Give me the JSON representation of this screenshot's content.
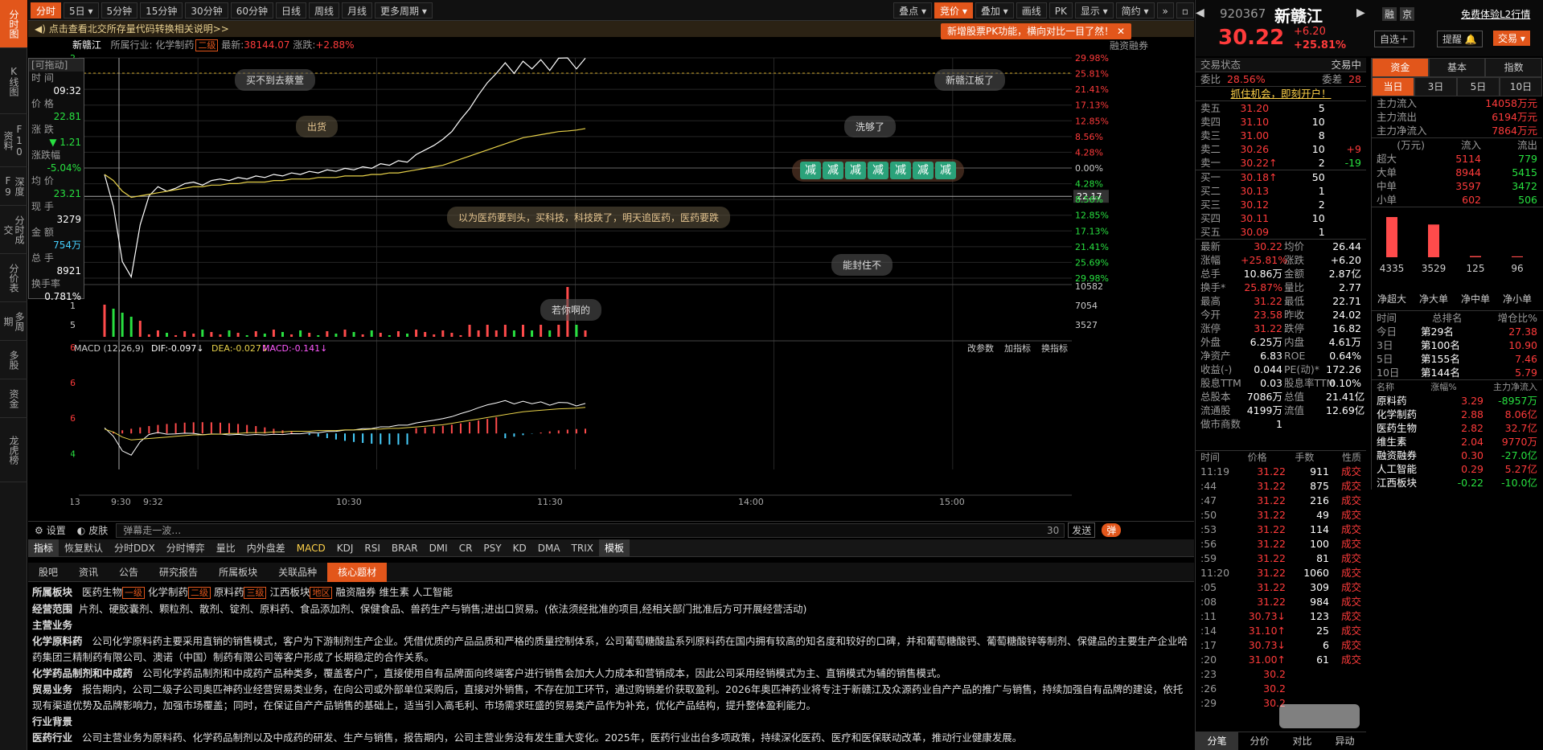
{
  "leftnav": [
    "分时图",
    "K线图",
    "F10资料",
    "深度F9",
    "分时成交",
    "分价表",
    "多周期",
    "多股",
    "资金",
    "龙虎榜"
  ],
  "toolbar": {
    "periods": [
      "分时",
      "5日",
      "5分钟",
      "15分钟",
      "30分钟",
      "60分钟",
      "日线",
      "周线",
      "月线",
      "更多周期"
    ],
    "right": [
      "叠点",
      "竞价",
      "叠加",
      "画线",
      "PK",
      "显示",
      "简约"
    ]
  },
  "notice": "点击查看北交所存量代码转换相关说明>>",
  "orangetip": "新增股票PK功能，横向对比一目了然！",
  "stock": {
    "name": "新赣江",
    "industry_label": "所属行业:",
    "industry": "化学制药",
    "industry_tag": "二级",
    "latest_label": "最新:",
    "latest": "38144.07",
    "change_label": "涨跌:",
    "change": "+2.88%",
    "margin": "融资融券"
  },
  "chart": {
    "left_axis": [
      "31.22",
      "30.31",
      "17.85",
      "16.82"
    ],
    "right_pct": [
      "29.98%",
      "25.81%",
      "21.41%",
      "17.13%",
      "12.85%",
      "8.56%",
      "4.28%",
      "0.00%",
      "4.28%",
      "8.56%",
      "12.85%",
      "17.13%",
      "21.41%",
      "25.69%",
      "29.98%"
    ],
    "crosshair_value": "22.17",
    "vol_axis": [
      "1637",
      "1091",
      "545"
    ],
    "vol_right": [
      "10582",
      "7054",
      "3527"
    ],
    "macd_label": "MACD (12,26,9)",
    "dif": "DIF:-0.097↓",
    "dea": "DEA:-0.027↓",
    "macd": "MACD:-0.141↓",
    "macd_axis": [
      "0.96",
      "0.56",
      "0.16",
      "-0.24"
    ],
    "macd_tools": [
      "改参数",
      "加指标",
      "换指标"
    ],
    "time_axis": [
      "08/13",
      "9:30",
      "9:32",
      "10:30",
      "11:30",
      "14:00",
      "15:00"
    ],
    "prices": [
      23.6,
      21.5,
      17.9,
      16.9,
      20.3,
      22.2,
      22.8,
      22.5,
      22.7,
      23.0,
      23.1,
      22.9,
      23.2,
      23.3,
      23.2,
      23.4,
      23.3,
      23.5,
      23.4,
      23.6,
      23.5,
      23.7,
      23.6,
      23.8,
      23.7,
      23.9,
      23.8,
      24.0,
      23.9,
      24.1,
      24.0,
      24.3,
      24.2,
      24.5,
      24.4,
      24.9,
      25.2,
      25.5,
      25.9,
      26.4,
      27.2,
      27.9,
      28.8,
      29.6,
      30.2,
      30.9,
      30.2,
      31.0,
      30.5,
      31.1,
      30.4,
      31.2,
      31.22,
      30.5,
      31.2
    ],
    "avg": [
      23.6,
      23.2,
      22.5,
      22.1,
      22.2,
      22.3,
      22.4,
      22.5,
      22.6,
      22.7,
      22.8,
      22.8,
      22.9,
      22.9,
      23.0,
      23.0,
      23.1,
      23.1,
      23.1,
      23.2,
      23.2,
      23.3,
      23.3,
      23.3,
      23.4,
      23.4,
      23.4,
      23.5,
      23.5,
      23.5,
      23.6,
      23.6,
      23.7,
      23.7,
      23.8,
      23.9,
      24.0,
      24.1,
      24.2,
      24.4,
      24.6,
      24.8,
      25.0,
      25.2,
      25.4,
      25.6,
      25.8,
      26.0,
      26.1,
      26.2,
      26.3,
      26.4,
      26.44,
      26.5,
      26.6
    ]
  },
  "info": {
    "drag": "[可拖动]",
    "time_label": "时 间",
    "time": "09:32",
    "price_label": "价 格",
    "price": "22.81",
    "chg_label": "涨 跌",
    "chg": "▼ 1.21",
    "pct_label": "涨跌幅",
    "pct": "-5.04%",
    "avg_label": "均 价",
    "avg": "23.21",
    "now_label": "现 手",
    "now": "3279",
    "amt_label": "金 额",
    "amt": "754万",
    "tot_label": "总 手",
    "tot": "8921",
    "turn_label": "换手率",
    "turn": "0.781%"
  },
  "bubbles": [
    "买不到去蔡萱",
    "新赣江板了",
    "出货",
    "洗够了",
    "以为医药要到头，买科技，科技跌了，明天追医药，医药要跌",
    "能封住不",
    "若你啊的"
  ],
  "jian": [
    "减",
    "减",
    "减",
    "减",
    "减",
    "减",
    "减"
  ],
  "chartbottom": {
    "settings": "设置",
    "skin": "皮肤",
    "danmu_placeholder": "弹幕走一波…",
    "count": "30",
    "send": "发送",
    "danmu": "弹"
  },
  "indtabs": [
    "指标",
    "恢复默认",
    "分时DDX",
    "分时博弈",
    "量比",
    "内外盘差",
    "MACD",
    "KDJ",
    "RSI",
    "BRAR",
    "DMI",
    "CR",
    "PSY",
    "KD",
    "DMA",
    "TRIX",
    "模板"
  ],
  "f10tabs": [
    "股吧",
    "资讯",
    "公告",
    "研究报告",
    "所属板块",
    "关联品种",
    "核心题材"
  ],
  "f10": {
    "l1": {
      "h": "所属板块",
      "items": [
        "医药生物",
        "化学制药",
        "原料药",
        "江西板块",
        "融资融券",
        "维生素",
        "人工智能"
      ],
      "tags": [
        "一级",
        "二级",
        "三级",
        "地区"
      ]
    },
    "l2": {
      "h": "经营范围",
      "t": "片剂、硬胶囊剂、颗粒剂、散剂、锭剂、原料药、食品添加剂、保健食品、兽药生产与销售;进出口贸易。(依法须经批准的项目,经相关部门批准后方可开展经营活动)"
    },
    "l3": "主营业务",
    "l4": {
      "h": "化学原料药",
      "t": "公司化学原料药主要采用直销的销售模式，客户为下游制剂生产企业。凭借优质的产品品质和严格的质量控制体系，公司葡萄糖酸盐系列原料药在国内拥有较高的知名度和较好的口碑，并和葡萄糖酸钙、葡萄糖酸锌等制剂、保健品的主要生产企业哈药集团三精制药有限公司、澳诺（中国）制药有限公司等客户形成了长期稳定的合作关系。"
    },
    "l5": {
      "h": "化学药品制剂和中成药",
      "t": "公司化学药品制剂和中成药产品种类多，覆盖客户广，直接使用自有品牌面向终端客户进行销售会加大人力成本和营销成本，因此公司采用经销模式为主、直销模式为辅的销售模式。"
    },
    "l6": {
      "h": "贸易业务",
      "t": "报告期内，公司二级子公司奥匹神药业经营贸易类业务，在向公司或外部单位采购后，直接对外销售，不存在加工环节，通过购销差价获取盈利。2026年奥匹神药业将专注于新赣江及众源药业自产产品的推广与销售，持续加强自有品牌的建设，依托现有渠道优势及品牌影响力，加强市场覆盖；同时，在保证自产产品销售的基础上，适当引入高毛利、市场需求旺盛的贸易类产品作为补充，优化产品结构，提升整体盈利能力。"
    },
    "l7": "行业背景",
    "l8": {
      "h": "医药行业",
      "t": "公司主营业务为原料药、化学药品制剂以及中成药的研发、生产与销售，报告期内，公司主营业务没有发生重大变化。2025年，医药行业出台多项政策，持续深化医药、医疗和医保联动改革，推动行业健康发展。"
    }
  },
  "right": {
    "code": "920367",
    "name": "新赣江",
    "price": "30.22",
    "chg": "+6.20",
    "pct": "+25.81%",
    "badges": [
      "融",
      "京"
    ],
    "trial": "免费体验L2行情",
    "btn_add": "自选＋",
    "btn_alert": "提醒",
    "btn_trade": "交易",
    "status_label": "交易状态",
    "status": "交易中",
    "wb_label": "委比",
    "wb": "28.56%",
    "wc_label": "委差",
    "wc": "28",
    "promo": "抓住机会，即刻开户！",
    "sells": [
      [
        "卖五",
        "31.20",
        "5",
        ""
      ],
      [
        "卖四",
        "31.10",
        "10",
        ""
      ],
      [
        "卖三",
        "31.00",
        "8",
        ""
      ],
      [
        "卖二",
        "30.26",
        "10",
        "+9"
      ],
      [
        "卖一",
        "30.22↑",
        "2",
        "-19"
      ]
    ],
    "buys": [
      [
        "买一",
        "30.18↑",
        "50"
      ],
      [
        "买二",
        "30.13",
        "1"
      ],
      [
        "买三",
        "30.12",
        "2"
      ],
      [
        "买四",
        "30.11",
        "10"
      ],
      [
        "买五",
        "30.09",
        "1"
      ]
    ],
    "quote": [
      [
        "最新",
        "30.22",
        "均价",
        "26.44"
      ],
      [
        "涨幅",
        "+25.81%",
        "涨跌",
        "+6.20"
      ],
      [
        "总手",
        "10.86万",
        "金额",
        "2.87亿"
      ],
      [
        "换手*",
        "25.87%",
        "量比",
        "2.77"
      ],
      [
        "最高",
        "31.22",
        "最低",
        "22.71"
      ],
      [
        "今开",
        "23.58",
        "昨收",
        "24.02"
      ],
      [
        "涨停",
        "31.22",
        "跌停",
        "16.82"
      ],
      [
        "外盘",
        "6.25万",
        "内盘",
        "4.61万"
      ],
      [
        "净资产",
        "6.83",
        "ROE",
        "0.64%"
      ],
      [
        "收益(-)",
        "0.044",
        "PE(动)*",
        "172.26"
      ],
      [
        "股息TTM",
        "0.03",
        "股息率TTM",
        "0.10%"
      ],
      [
        "总股本",
        "7086万",
        "总值",
        "21.41亿"
      ],
      [
        "流通股",
        "4199万",
        "流值",
        "12.69亿"
      ],
      [
        "做市商数",
        "1",
        "",
        ""
      ]
    ],
    "fund_tabs": [
      "资金",
      "基本",
      "指数"
    ],
    "day_tabs": [
      "当日",
      "3日",
      "5日",
      "10日"
    ],
    "flows": [
      [
        "主力流入",
        "14058万元"
      ],
      [
        "主力流出",
        "6194万元"
      ],
      [
        "主力净流入",
        "7864万元"
      ]
    ],
    "flow_head": [
      "(万元)",
      "流入",
      "流出"
    ],
    "flow_rows": [
      [
        "超大",
        "5114",
        "779"
      ],
      [
        "大单",
        "8944",
        "5415"
      ],
      [
        "中单",
        "3597",
        "3472"
      ],
      [
        "小单",
        "602",
        "506"
      ]
    ],
    "net_bars": {
      "values": [
        4335,
        3529,
        125,
        96
      ],
      "labels": [
        "净超大",
        "净大单",
        "净中单",
        "净小单"
      ]
    },
    "rank_head": [
      "时间",
      "总排名",
      "增仓比%"
    ],
    "ranks": [
      [
        "今日",
        "第29名",
        "27.38"
      ],
      [
        "3日",
        "第100名",
        "10.90"
      ],
      [
        "5日",
        "第155名",
        "7.46"
      ],
      [
        "10日",
        "第144名",
        "5.79"
      ]
    ],
    "sect_head": [
      "名称",
      "涨幅%",
      "主力净流入"
    ],
    "sectors": [
      [
        "原料药",
        "3.29",
        "-8957万"
      ],
      [
        "化学制药",
        "2.88",
        "8.06亿"
      ],
      [
        "医药生物",
        "2.82",
        "32.7亿"
      ],
      [
        "维生素",
        "2.04",
        "9770万"
      ],
      [
        "融资融券",
        "0.30",
        "-27.0亿"
      ],
      [
        "人工智能",
        "0.29",
        "5.27亿"
      ],
      [
        "江西板块",
        "-0.22",
        "-10.0亿"
      ]
    ],
    "tick_head": [
      "时间",
      "价格",
      "手数",
      "性质"
    ],
    "ticks": [
      [
        "11:19",
        "31.22",
        "911",
        "成交"
      ],
      [
        ":44",
        "31.22",
        "875",
        "成交"
      ],
      [
        ":47",
        "31.22",
        "216",
        "成交"
      ],
      [
        ":50",
        "31.22",
        "49",
        "成交"
      ],
      [
        ":53",
        "31.22",
        "114",
        "成交"
      ],
      [
        ":56",
        "31.22",
        "100",
        "成交"
      ],
      [
        ":59",
        "31.22",
        "81",
        "成交"
      ],
      [
        "11:20",
        "31.22",
        "1060",
        "成交"
      ],
      [
        ":05",
        "31.22",
        "309",
        "成交"
      ],
      [
        ":08",
        "31.22",
        "984",
        "成交"
      ],
      [
        ":11",
        "30.73↓",
        "123",
        "成交"
      ],
      [
        ":14",
        "31.10↑",
        "25",
        "成交"
      ],
      [
        ":17",
        "30.73↓",
        "6",
        "成交"
      ],
      [
        ":20",
        "31.00↑",
        "61",
        "成交"
      ],
      [
        ":23",
        "30.2",
        "",
        ""
      ],
      [
        ":26",
        "30.2",
        "",
        ""
      ],
      [
        ":29",
        "30.2",
        "",
        ""
      ]
    ],
    "bottom_tabs": [
      "分笔",
      "分价",
      "对比",
      "异动"
    ]
  },
  "colors": {
    "up": "#ff3b3b",
    "down": "#28e040",
    "accent": "#e2561b",
    "avg": "#e8d24a"
  }
}
